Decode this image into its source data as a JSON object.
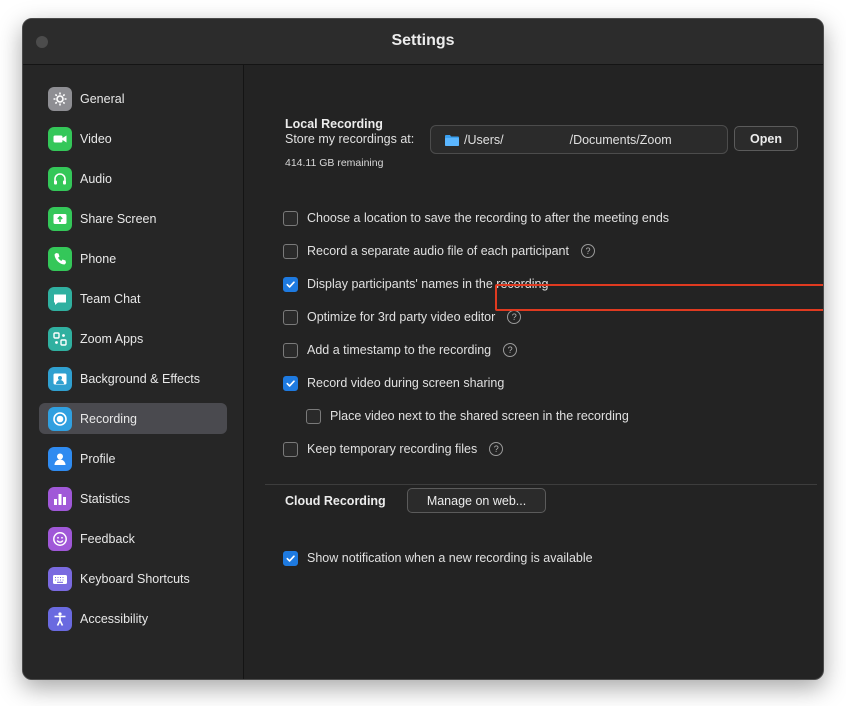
{
  "window": {
    "title": "Settings"
  },
  "sidebar": {
    "items": [
      {
        "label": "General",
        "icon": "gear-icon",
        "color": "#8e8e93",
        "active": false
      },
      {
        "label": "Video",
        "icon": "video-camera-icon",
        "color": "#34c759",
        "active": false
      },
      {
        "label": "Audio",
        "icon": "headphones-icon",
        "color": "#34c759",
        "active": false
      },
      {
        "label": "Share Screen",
        "icon": "share-screen-icon",
        "color": "#34c759",
        "active": false
      },
      {
        "label": "Phone",
        "icon": "phone-icon",
        "color": "#34c759",
        "active": false
      },
      {
        "label": "Team Chat",
        "icon": "chat-icon",
        "color": "#30b0a0",
        "active": false
      },
      {
        "label": "Zoom Apps",
        "icon": "apps-icon",
        "color": "#30b0a0",
        "active": false
      },
      {
        "label": "Background & Effects",
        "icon": "background-icon",
        "color": "#30a0d0",
        "active": false
      },
      {
        "label": "Recording",
        "icon": "record-icon",
        "color": "#30a0e0",
        "active": true
      },
      {
        "label": "Profile",
        "icon": "profile-icon",
        "color": "#2f8bf0",
        "active": false
      },
      {
        "label": "Statistics",
        "icon": "statistics-icon",
        "color": "#a058d8",
        "active": false
      },
      {
        "label": "Feedback",
        "icon": "feedback-icon",
        "color": "#a058d8",
        "active": false
      },
      {
        "label": "Keyboard Shortcuts",
        "icon": "keyboard-icon",
        "color": "#7a6ae0",
        "active": false
      },
      {
        "label": "Accessibility",
        "icon": "accessibility-icon",
        "color": "#6a6ae0",
        "active": false
      }
    ]
  },
  "local": {
    "title": "Local Recording",
    "store_label": "Store my recordings at:",
    "path_start": "/Users/",
    "path_end": "/Documents/Zoom",
    "open_label": "Open",
    "remaining": "414.11 GB remaining",
    "options": [
      {
        "label": "Choose a location to save the recording to after the meeting ends",
        "checked": false,
        "help": false,
        "indent": false
      },
      {
        "label": "Record a separate audio file of each participant",
        "checked": false,
        "help": true,
        "indent": false
      },
      {
        "label": "Display participants' names in the recording",
        "checked": true,
        "help": false,
        "indent": false
      },
      {
        "label": "Optimize for 3rd party video editor",
        "checked": false,
        "help": true,
        "indent": false
      },
      {
        "label": "Add a timestamp to the recording",
        "checked": false,
        "help": true,
        "indent": false
      },
      {
        "label": "Record video during screen sharing",
        "checked": true,
        "help": false,
        "indent": false
      },
      {
        "label": "Place video next to the shared screen in the recording",
        "checked": false,
        "help": false,
        "indent": true
      },
      {
        "label": "Keep temporary recording files",
        "checked": false,
        "help": true,
        "indent": false
      }
    ]
  },
  "cloud": {
    "title": "Cloud Recording",
    "manage_label": "Manage on web...",
    "notify": {
      "label": "Show notification when a new recording is available",
      "checked": true
    }
  },
  "help_glyph": "?",
  "colors": {
    "accent": "#1e7ae0",
    "highlight": "#e03a20"
  }
}
